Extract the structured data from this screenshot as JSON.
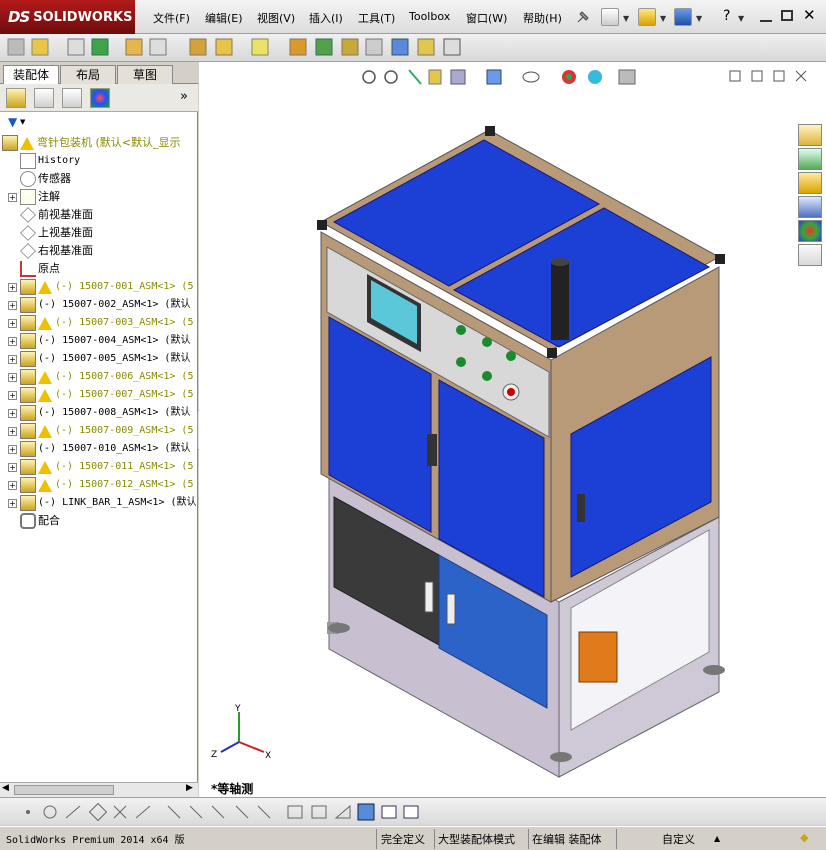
{
  "app": {
    "logo_prefix": "DS",
    "logo_name": "SOLIDWORKS"
  },
  "menus": [
    "文件(F)",
    "编辑(E)",
    "视图(V)",
    "插入(I)",
    "工具(T)",
    "Toolbox",
    "窗口(W)",
    "帮助(H)"
  ],
  "panel_tabs": [
    "装配体",
    "布局",
    "草图"
  ],
  "tree": {
    "root": "弯针包装机  (默认<默认_显示",
    "items": [
      {
        "label": "History",
        "type": "history"
      },
      {
        "label": "传感器",
        "type": "sensor"
      },
      {
        "label": "注解",
        "type": "annotation",
        "expand": "+"
      },
      {
        "label": "前视基准面",
        "type": "plane"
      },
      {
        "label": "上视基准面",
        "type": "plane"
      },
      {
        "label": "右视基准面",
        "type": "plane"
      },
      {
        "label": "原点",
        "type": "origin"
      },
      {
        "label": "(-) 15007-001_ASM<1> (5",
        "type": "asm",
        "warn": true,
        "expand": "+"
      },
      {
        "label": "(-) 15007-002_ASM<1> (默认",
        "type": "asm",
        "warn": false,
        "expand": "+"
      },
      {
        "label": "(-) 15007-003_ASM<1> (5",
        "type": "asm",
        "warn": true,
        "expand": "+"
      },
      {
        "label": "(-) 15007-004_ASM<1> (默认",
        "type": "asm",
        "warn": false,
        "expand": "+"
      },
      {
        "label": "(-) 15007-005_ASM<1> (默认",
        "type": "asm",
        "warn": false,
        "expand": "+"
      },
      {
        "label": "(-) 15007-006_ASM<1> (5",
        "type": "asm",
        "warn": true,
        "expand": "+"
      },
      {
        "label": "(-) 15007-007_ASM<1> (5",
        "type": "asm",
        "warn": true,
        "expand": "+"
      },
      {
        "label": "(-) 15007-008_ASM<1> (默认",
        "type": "asm",
        "warn": false,
        "expand": "+"
      },
      {
        "label": "(-) 15007-009_ASM<1> (5",
        "type": "asm",
        "warn": true,
        "expand": "+"
      },
      {
        "label": "(-) 15007-010_ASM<1> (默认",
        "type": "asm",
        "warn": false,
        "expand": "+"
      },
      {
        "label": "(-) 15007-011_ASM<1> (5",
        "type": "asm",
        "warn": true,
        "expand": "+"
      },
      {
        "label": "(-) 15007-012_ASM<1> (5",
        "type": "asm",
        "warn": true,
        "expand": "+"
      },
      {
        "label": "(-) LINK_BAR_1_ASM<1> (默认",
        "type": "asm",
        "warn": false,
        "expand": "+"
      },
      {
        "label": "配合",
        "type": "mate"
      }
    ]
  },
  "viewport": {
    "view_name": "*等轴测",
    "axis_labels": {
      "x": "X",
      "y": "Y",
      "z": "Z"
    },
    "colors": {
      "panel_blue": "#1c3fd6",
      "frame_tan": "#b89a78",
      "cabinet_dark": "#3a3a3a",
      "door_blue": "#2b63c8",
      "control_panel": "#d8d8d8"
    }
  },
  "status": {
    "product": "SolidWorks Premium 2014 x64 版",
    "fully_defined": "完全定义",
    "large_assembly": "大型装配体模式",
    "editing": "在编辑 装配体",
    "custom": "自定义"
  }
}
